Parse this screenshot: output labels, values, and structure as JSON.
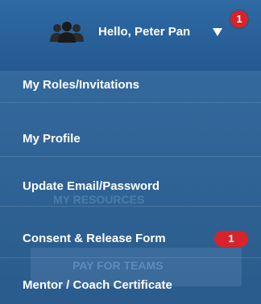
{
  "header": {
    "greeting": "Hello, Peter Pan",
    "notification_count": "1",
    "user_icon": "users-icon",
    "dropdown_icon": "caret-down-icon"
  },
  "menu": {
    "items": [
      {
        "label": "My Roles/Invitations"
      },
      {
        "label": "My Profile"
      },
      {
        "label": "Update Email/Password"
      },
      {
        "label": "Consent & Release Form",
        "badge": "1"
      },
      {
        "label": "Mentor / Coach Certificate"
      }
    ]
  },
  "background": {
    "resources_text": "MY RESOURCES",
    "pay_button_text": "PAY FOR TEAMS"
  },
  "colors": {
    "header_bg": "#2e6aa4",
    "menu_bg": "#2a5e91",
    "badge": "#d9232a",
    "text": "#ffffff"
  }
}
